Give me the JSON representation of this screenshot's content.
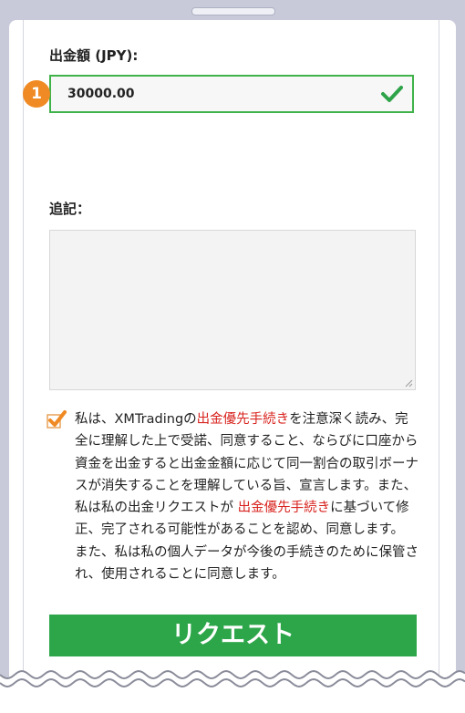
{
  "form": {
    "amount_label": "出金額 (JPY):",
    "amount_value": "30000.00",
    "step_number": "1",
    "notes_label": "追記：",
    "notes_value": ""
  },
  "consent": {
    "text_1": "私は、XMTradingの",
    "link_1": "出金優先手続き",
    "text_2": "を注意深く読み、完全に理解した上で受諾、同意すること、ならびに口座から資金を出金すると出金金額に応じて同一割合の取引ボーナスが消失することを理解している旨、宣言します。また、私は私の出金リクエストが",
    "link_2": "出金優先手続き",
    "text_3": "に基づいて修正、完了される可能性があることを認め、同意します。 また、私は私の個人データが今後の手続きのために保管され、使用されることに同意します。"
  },
  "submit_label": "リクエスト",
  "colors": {
    "accent_green": "#2da64a",
    "field_border": "#40b24a",
    "badge_orange": "#f08a24",
    "link_red": "#d8241f",
    "frame": "#c9cad9"
  },
  "icons": [
    "checkmark-icon",
    "checkbox-checked-icon",
    "resize-grip-icon"
  ]
}
